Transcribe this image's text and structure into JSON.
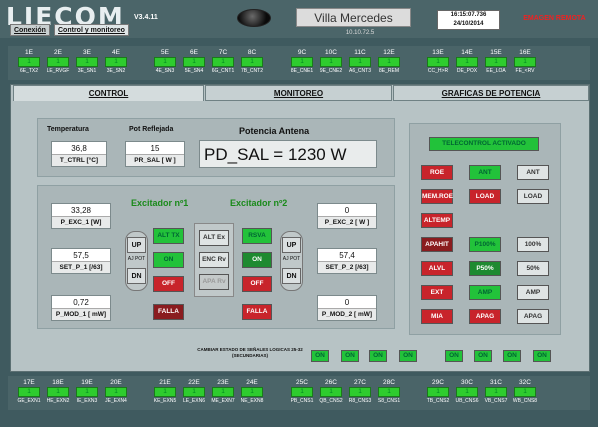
{
  "header": {
    "logo": "LIECOM",
    "version": "V3.4.11",
    "station": "Villa Mercedes",
    "ip": "10.10.72.5",
    "time": "16:15:07.736",
    "date": "24/10/2014",
    "alarm": "EMAGEN REMOTA",
    "tabs": [
      "Conexión",
      "Control y monitoreo"
    ]
  },
  "top_channels": [
    {
      "code": "1E",
      "val": "1",
      "name": "6E_TX2"
    },
    {
      "code": "2E",
      "val": "1",
      "name": "LE_RVGF"
    },
    {
      "code": "3E",
      "val": "1",
      "name": "3E_SN1"
    },
    {
      "code": "4E",
      "val": "1",
      "name": "3E_SN2"
    },
    {
      "code": "5E",
      "val": "1",
      "name": "4E_SN3"
    },
    {
      "code": "6E",
      "val": "1",
      "name": "5E_SN4"
    },
    {
      "code": "7C",
      "val": "1",
      "name": "6G_CNT1"
    },
    {
      "code": "8C",
      "val": "1",
      "name": "7B_CNT2"
    },
    {
      "code": "9C",
      "val": "1",
      "name": "8E_CNE1"
    },
    {
      "code": "10C",
      "val": "1",
      "name": "9E_CNE2"
    },
    {
      "code": "11C",
      "val": "1",
      "name": "A6_CNT3"
    },
    {
      "code": "12E",
      "val": "1",
      "name": "8E_REM"
    },
    {
      "code": "13E",
      "val": "1",
      "name": "CC_H>R"
    },
    {
      "code": "14E",
      "val": "1",
      "name": "DE_POX"
    },
    {
      "code": "15E",
      "val": "1",
      "name": "EE_LOA"
    },
    {
      "code": "16E",
      "val": "1",
      "name": "FE_<RV"
    }
  ],
  "bottom_channels": [
    {
      "code": "17E",
      "val": "1",
      "name": "GE_EXN1"
    },
    {
      "code": "18E",
      "val": "1",
      "name": "HE_EXN2"
    },
    {
      "code": "19E",
      "val": "1",
      "name": "IE_EXN3"
    },
    {
      "code": "20E",
      "val": "1",
      "name": "JE_EXN4"
    },
    {
      "code": "21E",
      "val": "1",
      "name": "KE_EXN5"
    },
    {
      "code": "22E",
      "val": "1",
      "name": "LE_EXN6"
    },
    {
      "code": "23E",
      "val": "1",
      "name": "ME_EXN7"
    },
    {
      "code": "24E",
      "val": "1",
      "name": "NE_EXN8"
    },
    {
      "code": "25C",
      "val": "1",
      "name": "PB_CNS1"
    },
    {
      "code": "26C",
      "val": "1",
      "name": "QB_CNS2"
    },
    {
      "code": "27C",
      "val": "1",
      "name": "R8_CNS3"
    },
    {
      "code": "28C",
      "val": "1",
      "name": "S8_CNS1"
    },
    {
      "code": "29C",
      "val": "1",
      "name": "TB_CNS2"
    },
    {
      "code": "30C",
      "val": "1",
      "name": "UB_CNS6"
    },
    {
      "code": "31C",
      "val": "1",
      "name": "VB_CNS7"
    },
    {
      "code": "32C",
      "val": "1",
      "name": "WB_CNS8"
    }
  ],
  "tabs": [
    "CONTROL",
    "MONITOREO",
    "GRAFICAS DE POTENCIA"
  ],
  "readings": {
    "temp_label": "Temperatura",
    "temp_value": "36,8",
    "temp_unit": "T_CTRL [°C]",
    "refl_label": "Pot Reflejada",
    "refl_value": "15",
    "refl_unit": "PR_SAL [ W ]",
    "ant_label": "Potencia Antena",
    "ant_value": "PD_SAL = 1230 W"
  },
  "exc1": {
    "title": "Excitador nº1",
    "p_exc": "33,28",
    "p_exc_u": "P_EXC_1 [W]",
    "set_p": "57,5",
    "set_p_u": "SET_P_1 [/63]",
    "p_mod": "0,72",
    "p_mod_u": "P_MOD_1 [ mW]",
    "up": "UP",
    "ajpot": "AJ POT",
    "dn": "DN",
    "b1": "ALT TX",
    "b2": "ON",
    "b3": "OFF",
    "b4": "FALLA"
  },
  "exc2": {
    "title": "Excitador nº2",
    "p_exc": "0",
    "p_exc_u": "P_EXC_2 [ W ]",
    "set_p": "57,4",
    "set_p_u": "SET_P_2 [/63]",
    "p_mod": "0",
    "p_mod_u": "P_MOD_2 [ mW]",
    "up": "UP",
    "ajpot": "AJ POT",
    "dn": "DN",
    "b1": "RSVA",
    "b2": "ON",
    "b3": "OFF",
    "b4": "FALLA"
  },
  "mid": {
    "b1": "ALT Ex",
    "b2": "ENC Rv",
    "b3": "APA Rv"
  },
  "right": {
    "telecontrol": "TELECONTROL ACTIVADO",
    "rows": [
      [
        "ROE",
        "ANT",
        "ANT"
      ],
      [
        "MEM.ROE",
        "LOAD",
        "LOAD"
      ],
      [
        "ALTEMP",
        "",
        ""
      ],
      [
        "APAHIT",
        "P100%",
        "100%"
      ],
      [
        "ALVL",
        "P50%",
        "50%"
      ],
      [
        "EXT",
        "AMP",
        "AMP"
      ],
      [
        "MIA",
        "APAG",
        "APAG"
      ]
    ]
  },
  "bottom_bar": {
    "label": "CAMBIAR ESTADO DE SEÑALES LOGICAS 25-32 (SECUNDARIAS)",
    "buttons": [
      "ON",
      "ON",
      "ON",
      "ON",
      "ON",
      "ON",
      "ON",
      "ON"
    ]
  },
  "colors": {
    "green": "#22c23a",
    "red": "#c8242b",
    "background": "#3f5a5f"
  }
}
